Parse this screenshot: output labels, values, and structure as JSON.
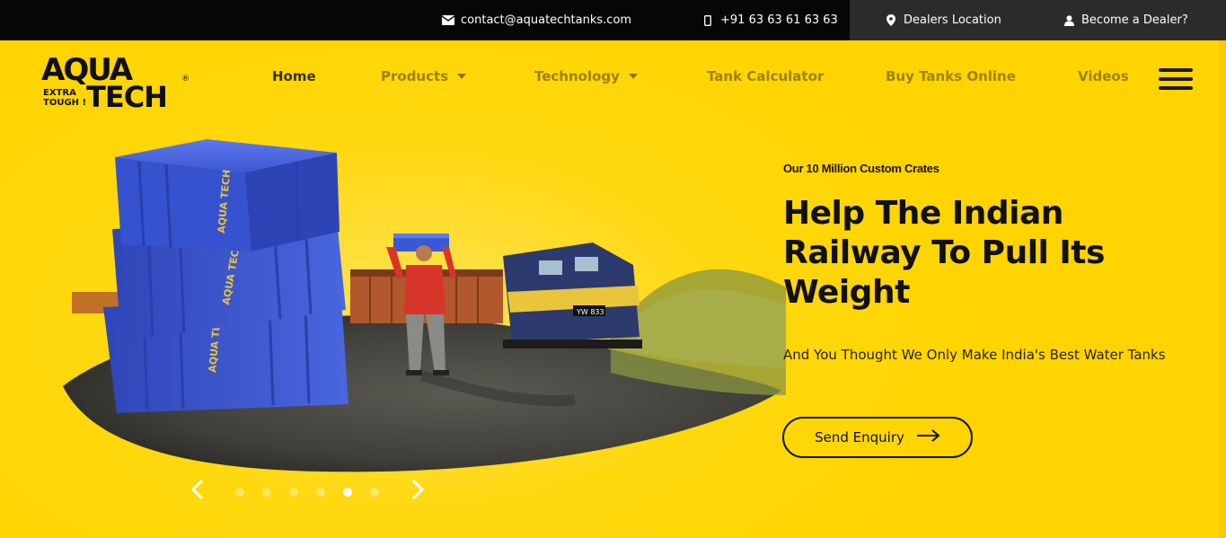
{
  "topbar": {
    "email": "contact@aquatechtanks.com",
    "phone": "+91 63 63 61 63 63",
    "dealers_location": "Dealers Location",
    "become_dealer": "Become a Dealer?"
  },
  "logo": {
    "text_line1": "AQUA",
    "text_extra": "EXTRA",
    "text_tough": "TOUGH !",
    "text_tech": "TECH",
    "registered": "®"
  },
  "nav": {
    "items": [
      {
        "label": "Home",
        "active": true
      },
      {
        "label": "Products",
        "has_dropdown": true
      },
      {
        "label": "Technology",
        "has_dropdown": true
      },
      {
        "label": "Tank Calculator"
      },
      {
        "label": "Buy Tanks Online"
      },
      {
        "label": "Videos"
      }
    ],
    "menu_icon": "hamburger-icon"
  },
  "hero": {
    "eyebrow": "Our 10 Million Custom Crates",
    "headline": "Help The Indian Railway To Pull Its Weight",
    "subtext": "And You Thought We Only Make India's Best Water Tanks",
    "cta_label": "Send Enquiry",
    "crate_brand": "AQUA TECH",
    "train_number": "YW 833"
  },
  "slider": {
    "total_slides": 6,
    "active_slide": 5,
    "prev_icon": "chevron-left-icon",
    "next_icon": "chevron-right-icon"
  },
  "colors": {
    "brand_yellow": "#ffd400",
    "topbar_bg": "#060606",
    "crate_blue": "#3d5bd6",
    "text_dark": "#111111"
  }
}
